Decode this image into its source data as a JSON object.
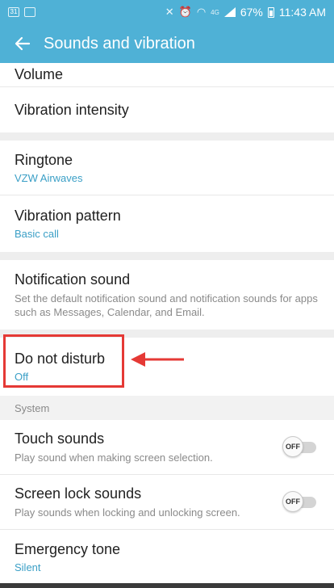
{
  "status_bar": {
    "left_icons": [
      "calendar-icon",
      "image-icon"
    ],
    "battery": "67%",
    "time": "11:43 AM",
    "right_icons": [
      "mute-icon",
      "alarm-icon",
      "wifi-icon",
      "signal-icon",
      "battery-icon"
    ],
    "network_label": "4G"
  },
  "app_bar": {
    "title": "Sounds and vibration",
    "back_icon": "arrow-left-icon"
  },
  "items": {
    "volume": {
      "title": "Volume"
    },
    "vibration_intensity": {
      "title": "Vibration intensity"
    },
    "ringtone": {
      "title": "Ringtone",
      "value": "VZW Airwaves"
    },
    "vibration_pattern": {
      "title": "Vibration pattern",
      "value": "Basic call"
    },
    "notification_sound": {
      "title": "Notification sound",
      "description": "Set the default notification sound and notification sounds for apps such as Messages, Calendar, and Email."
    },
    "do_not_disturb": {
      "title": "Do not disturb",
      "value": "Off"
    },
    "system_header": "System",
    "touch_sounds": {
      "title": "Touch sounds",
      "description": "Play sound when making screen selection.",
      "toggle": "OFF"
    },
    "screen_lock_sounds": {
      "title": "Screen lock sounds",
      "description": "Play sounds when locking and unlocking screen.",
      "toggle": "OFF"
    },
    "emergency_tone": {
      "title": "Emergency tone",
      "value": "Silent"
    }
  },
  "colors": {
    "app_bar": "#4fb1d6",
    "accent_text": "#3a9fc6",
    "annotation_red": "#e53935"
  }
}
